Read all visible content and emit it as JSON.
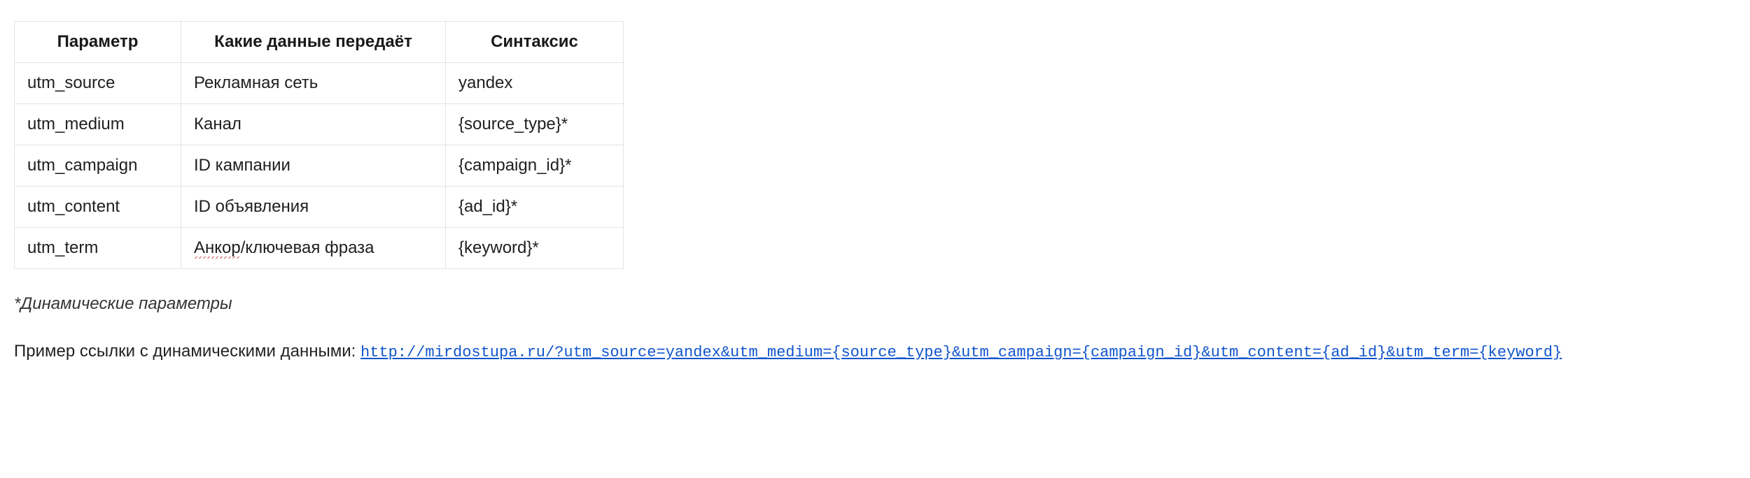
{
  "table": {
    "headers": {
      "param": "Параметр",
      "data": "Какие данные передаёт",
      "syntax": "Синтаксис"
    },
    "rows": [
      {
        "param": "utm_source",
        "data_pre": "",
        "data_spell": "",
        "data_post": "Рекламная сеть",
        "syntax": "yandex"
      },
      {
        "param": "utm_medium",
        "data_pre": "",
        "data_spell": "",
        "data_post": "Канал",
        "syntax": "{source_type}*"
      },
      {
        "param": "utm_campaign",
        "data_pre": "",
        "data_spell": "",
        "data_post": "ID кампании",
        "syntax": "{campaign_id}*"
      },
      {
        "param": "utm_content",
        "data_pre": "",
        "data_spell": "",
        "data_post": "ID объявления",
        "syntax": "{ad_id}*"
      },
      {
        "param": "utm_term",
        "data_pre": "",
        "data_spell": "Анкор",
        "data_post": "/ключевая фраза",
        "syntax": "{keyword}*"
      }
    ]
  },
  "note": "*Динамические параметры",
  "example": {
    "prefix": "Пример ссылки с динамическими данными: ",
    "url": "http://mirdostupa.ru/?utm_source=yandex&utm_medium={source_type}&utm_campaign={campaign_id}&utm_content={ad_id}&utm_term={keyword}"
  }
}
